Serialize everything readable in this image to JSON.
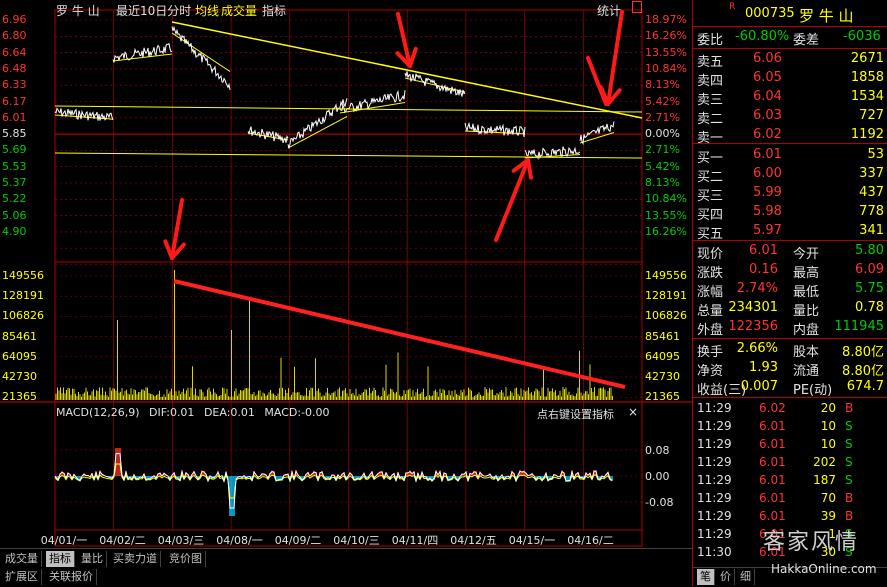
{
  "header": {
    "stock_name": "罗 牛 山",
    "period": "最近10日分时",
    "avg_line": "均线",
    "volume": "成交量",
    "indicator": "指标",
    "stats": "统计"
  },
  "price_axis_left": [
    "6.96",
    "6.80",
    "6.64",
    "6.48",
    "6.33",
    "6.17",
    "6.01",
    "5.85",
    "5.69",
    "5.53",
    "5.37",
    "5.22",
    "5.06",
    "4.90"
  ],
  "pct_axis_right": [
    "18.97%",
    "16.26%",
    "13.55%",
    "10.84%",
    "8.13%",
    "5.42%",
    "2.71%",
    "0.00%",
    "2.71%",
    "5.42%",
    "8.13%",
    "10.84%",
    "13.55%",
    "16.26%"
  ],
  "volume_axis": [
    "149556",
    "128191",
    "106826",
    "85461",
    "64095",
    "42730",
    "21365"
  ],
  "macd": {
    "title": "MACD(12,26,9)",
    "dif": "DIF:0.01",
    "dea": "DEA:0.01",
    "macd": "MACD:-0.00",
    "hint": "点右键设置指标",
    "close": "×",
    "axis": [
      "0.08",
      "0.00",
      "-0.08"
    ]
  },
  "dates": [
    "04/01/一",
    "04/02/二",
    "04/03/三",
    "04/08/一",
    "04/09/二",
    "04/10/三",
    "04/11/四",
    "04/12/五",
    "04/15/一",
    "04/16/二"
  ],
  "bottom_tabs_row1": [
    "成交量",
    "指标",
    "量比",
    "买卖力道",
    "竞价图"
  ],
  "bottom_tabs_row2": [
    "扩展区",
    "关联报价"
  ],
  "active_tab": "指标",
  "quote": {
    "badge": "R",
    "code": "000735",
    "name": "罗 牛 山",
    "weibi_label": "委比",
    "weibi": "-60.80%",
    "weicha_label": "委差",
    "weicha": "-6036",
    "sells": [
      {
        "label": "卖五",
        "price": "6.06",
        "vol": "2671"
      },
      {
        "label": "卖四",
        "price": "6.05",
        "vol": "1858"
      },
      {
        "label": "卖三",
        "price": "6.04",
        "vol": "1534"
      },
      {
        "label": "卖二",
        "price": "6.03",
        "vol": "727"
      },
      {
        "label": "卖一",
        "price": "6.02",
        "vol": "1192"
      }
    ],
    "buys": [
      {
        "label": "买一",
        "price": "6.01",
        "vol": "53"
      },
      {
        "label": "买二",
        "price": "6.00",
        "vol": "337"
      },
      {
        "label": "买三",
        "price": "5.99",
        "vol": "437"
      },
      {
        "label": "买四",
        "price": "5.98",
        "vol": "778"
      },
      {
        "label": "买五",
        "price": "5.97",
        "vol": "341"
      }
    ],
    "stats": [
      {
        "l1": "现价",
        "v1": "6.01",
        "l2": "今开",
        "v2": "5.80"
      },
      {
        "l1": "涨跌",
        "v1": "0.16",
        "l2": "最高",
        "v2": "6.09"
      },
      {
        "l1": "涨幅",
        "v1": "2.74%",
        "l2": "最低",
        "v2": "5.75"
      },
      {
        "l1": "总量",
        "v1": "234301",
        "l2": "量比",
        "v2": "0.78"
      },
      {
        "l1": "外盘",
        "v1": "122356",
        "l2": "内盘",
        "v2": "111945"
      }
    ],
    "stats2": [
      {
        "l1": "换手",
        "v1": "2.66%",
        "l2": "股本",
        "v2": "8.80亿"
      },
      {
        "l1": "净资",
        "v1": "1.93",
        "l2": "流通",
        "v2": "8.80亿"
      },
      {
        "l1": "收益(三)",
        "v1": "0.007",
        "l2": "PE(动)",
        "v2": "674.7"
      }
    ],
    "ticks": [
      {
        "time": "11:29",
        "price": "6.02",
        "vol": "20",
        "bs": "B"
      },
      {
        "time": "11:29",
        "price": "6.01",
        "vol": "10",
        "bs": "S"
      },
      {
        "time": "11:29",
        "price": "6.01",
        "vol": "10",
        "bs": "S"
      },
      {
        "time": "11:29",
        "price": "6.01",
        "vol": "202",
        "bs": "S"
      },
      {
        "time": "11:29",
        "price": "6.01",
        "vol": "187",
        "bs": "S"
      },
      {
        "time": "11:29",
        "price": "6.01",
        "vol": "70",
        "bs": "B"
      },
      {
        "time": "11:29",
        "price": "6.01",
        "vol": "39",
        "bs": "B"
      },
      {
        "time": "11:29",
        "price": "6.01",
        "vol": "1",
        "bs": "S"
      },
      {
        "time": "11:30",
        "price": "6.01",
        "vol": "30",
        "bs": "S"
      }
    ],
    "bottom_tabs": [
      "笔",
      "价",
      "细"
    ],
    "watermark_url": "HakkaOnline.com"
  },
  "colors": {
    "up": "#ff3333",
    "down": "#00cc00",
    "price_line": "#ffffff",
    "avg_line": "#ffff00",
    "grid": "#b00000"
  }
}
